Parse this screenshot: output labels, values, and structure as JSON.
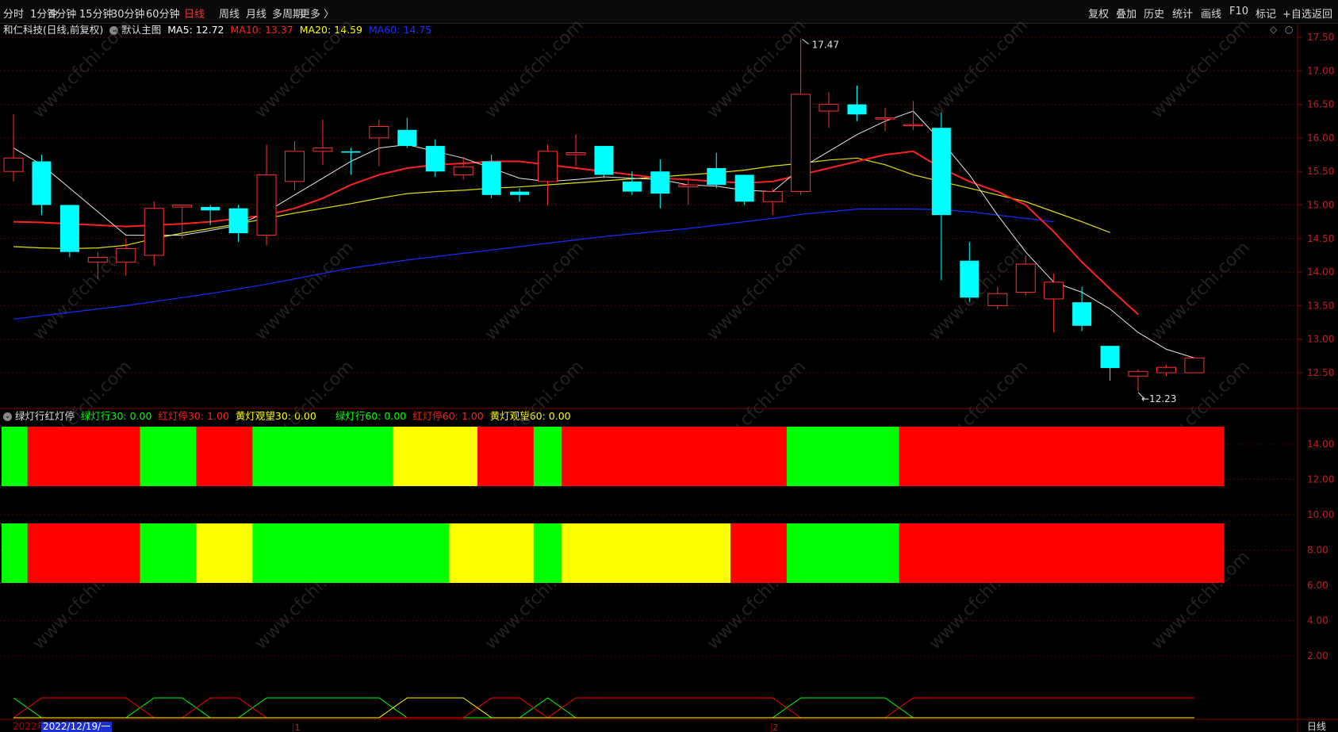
{
  "toolbar": {
    "left_items": [
      "分时",
      "1分钟",
      "5分钟",
      "15分钟",
      "30分钟",
      "60分钟",
      "日线",
      "周线",
      "月线",
      "多周期",
      "更多 〉"
    ],
    "active": "日线",
    "right_items": [
      "复权",
      "叠加",
      "历史",
      "统计",
      "画线",
      "F10",
      "标记",
      "+自选",
      "返回"
    ]
  },
  "main_legend": {
    "title": "和仁科技(日线,前复权)",
    "template": "默认主图",
    "ma": [
      {
        "label": "MA5: 12.72",
        "color": "#ffffff"
      },
      {
        "label": "MA10: 13.37",
        "color": "#ff2020"
      },
      {
        "label": "MA20: 14.59",
        "color": "#ffff00"
      },
      {
        "label": "MA60: 14.75",
        "color": "#2030ff"
      }
    ]
  },
  "indicator_legend": {
    "title": "绿灯行红灯停",
    "items": [
      {
        "label": "绿灯行30: 0.00",
        "color": "#00ff00"
      },
      {
        "label": "红灯停30: 1.00",
        "color": "#ff2020"
      },
      {
        "label": "黄灯观望30: 0.00",
        "color": "#ffff00"
      },
      {
        "label": "绿灯行60: 0.00",
        "color": "#00ff00"
      },
      {
        "label": "红灯停60: 1.00",
        "color": "#ff2020"
      },
      {
        "label": "黄灯观望60: 0.00",
        "color": "#ffff00"
      }
    ]
  },
  "price_axis": [
    "17.50",
    "17.00",
    "16.50",
    "16.00",
    "15.50",
    "15.00",
    "14.50",
    "14.00",
    "13.50",
    "13.00",
    "12.50"
  ],
  "indicator_axis": [
    "14.00",
    "12.00",
    "10.00",
    "8.00",
    "6.00",
    "4.00",
    "2.00"
  ],
  "annotations": {
    "high": "17.47",
    "low": "12.23"
  },
  "bottom": {
    "prefix": "2022年",
    "date": "2022/12/19/一",
    "month_marks": [
      "1",
      "2"
    ],
    "period": "日线"
  },
  "watermark": "www.cfchi.com",
  "colors": {
    "up": "#ff3030",
    "down": "#00ffff",
    "green": "#00ff00",
    "red": "#ff0000",
    "yellow": "#ffff00",
    "grid": "#5a0000"
  },
  "chart_data": {
    "type": "candlestick",
    "candles": [
      {
        "o": 15.5,
        "c": 15.7,
        "h": 16.35,
        "l": 15.35
      },
      {
        "o": 15.65,
        "c": 15.0,
        "h": 15.75,
        "l": 14.85
      },
      {
        "o": 15.0,
        "c": 14.3,
        "h": 15.0,
        "l": 14.22
      },
      {
        "o": 14.15,
        "c": 14.22,
        "h": 14.3,
        "l": 13.9
      },
      {
        "o": 14.15,
        "c": 14.35,
        "h": 14.5,
        "l": 13.95
      },
      {
        "o": 14.25,
        "c": 14.95,
        "h": 15.05,
        "l": 14.1
      },
      {
        "o": 14.97,
        "c": 15.0,
        "h": 15.0,
        "l": 14.5
      },
      {
        "o": 14.97,
        "c": 14.92,
        "h": 15.0,
        "l": 14.7
      },
      {
        "o": 14.95,
        "c": 14.58,
        "h": 15.0,
        "l": 14.45
      },
      {
        "o": 14.55,
        "c": 15.45,
        "h": 15.9,
        "l": 14.4
      },
      {
        "o": 15.35,
        "c": 15.8,
        "h": 15.95,
        "l": 15.22
      },
      {
        "o": 15.8,
        "c": 15.85,
        "h": 16.27,
        "l": 15.6
      },
      {
        "o": 15.8,
        "c": 15.78,
        "h": 15.85,
        "l": 15.45
      },
      {
        "o": 16.0,
        "c": 16.17,
        "h": 16.27,
        "l": 15.58
      },
      {
        "o": 16.12,
        "c": 15.88,
        "h": 16.3,
        "l": 15.85
      },
      {
        "o": 15.88,
        "c": 15.5,
        "h": 15.98,
        "l": 15.42
      },
      {
        "o": 15.45,
        "c": 15.57,
        "h": 15.72,
        "l": 15.38
      },
      {
        "o": 15.65,
        "c": 15.15,
        "h": 15.75,
        "l": 15.1
      },
      {
        "o": 15.2,
        "c": 15.15,
        "h": 15.25,
        "l": 15.05
      },
      {
        "o": 15.35,
        "c": 15.8,
        "h": 15.9,
        "l": 15.0
      },
      {
        "o": 15.75,
        "c": 15.78,
        "h": 16.05,
        "l": 15.58
      },
      {
        "o": 15.88,
        "c": 15.45,
        "h": 15.88,
        "l": 15.4
      },
      {
        "o": 15.35,
        "c": 15.2,
        "h": 15.5,
        "l": 15.15
      },
      {
        "o": 15.5,
        "c": 15.17,
        "h": 15.68,
        "l": 14.95
      },
      {
        "o": 15.27,
        "c": 15.3,
        "h": 15.4,
        "l": 15.0
      },
      {
        "o": 15.55,
        "c": 15.3,
        "h": 15.78,
        "l": 15.25
      },
      {
        "o": 15.45,
        "c": 15.05,
        "h": 15.45,
        "l": 15.0
      },
      {
        "o": 15.05,
        "c": 15.2,
        "h": 15.25,
        "l": 14.85
      },
      {
        "o": 15.2,
        "c": 16.65,
        "h": 17.47,
        "l": 15.15
      },
      {
        "o": 16.4,
        "c": 16.5,
        "h": 16.68,
        "l": 16.15
      },
      {
        "o": 16.5,
        "c": 16.35,
        "h": 16.78,
        "l": 16.25
      },
      {
        "o": 16.28,
        "c": 16.3,
        "h": 16.45,
        "l": 16.1
      },
      {
        "o": 16.2,
        "c": 16.2,
        "h": 16.55,
        "l": 16.12
      },
      {
        "o": 16.15,
        "c": 14.85,
        "h": 16.38,
        "l": 13.88
      },
      {
        "o": 14.17,
        "c": 13.62,
        "h": 14.45,
        "l": 13.55
      },
      {
        "o": 13.5,
        "c": 13.68,
        "h": 13.78,
        "l": 13.45
      },
      {
        "o": 13.7,
        "c": 14.12,
        "h": 14.25,
        "l": 13.65
      },
      {
        "o": 13.6,
        "c": 13.85,
        "h": 13.98,
        "l": 13.1
      },
      {
        "o": 13.55,
        "c": 13.2,
        "h": 13.78,
        "l": 13.12
      },
      {
        "o": 12.9,
        "c": 12.57,
        "h": 12.9,
        "l": 12.38
      },
      {
        "o": 12.45,
        "c": 12.52,
        "h": 12.55,
        "l": 12.23
      },
      {
        "o": 12.5,
        "c": 12.58,
        "h": 12.62,
        "l": 12.45
      },
      {
        "o": 12.5,
        "c": 12.72,
        "h": 12.72,
        "l": 12.5
      }
    ],
    "ma5": [
      15.85,
      15.6,
      15.25,
      14.9,
      14.55,
      14.55,
      14.55,
      14.62,
      14.7,
      14.9,
      15.15,
      15.4,
      15.65,
      15.85,
      15.9,
      15.8,
      15.7,
      15.55,
      15.4,
      15.35,
      15.38,
      15.42,
      15.4,
      15.38,
      15.3,
      15.28,
      15.22,
      15.2,
      15.55,
      15.8,
      16.05,
      16.25,
      16.4,
      15.95,
      15.45,
      14.85,
      14.3,
      13.85,
      13.7,
      13.45,
      13.1,
      12.85,
      12.72
    ],
    "ma10": [
      14.75,
      14.74,
      14.72,
      14.7,
      14.68,
      14.7,
      14.72,
      14.75,
      14.8,
      14.85,
      14.95,
      15.1,
      15.3,
      15.45,
      15.55,
      15.6,
      15.62,
      15.65,
      15.65,
      15.6,
      15.55,
      15.5,
      15.45,
      15.4,
      15.38,
      15.35,
      15.33,
      15.35,
      15.45,
      15.55,
      15.65,
      15.75,
      15.8,
      15.55,
      15.35,
      15.2,
      15.0,
      14.6,
      14.15,
      13.75,
      13.37
    ],
    "ma10_start": 0,
    "ma20": [
      14.38,
      14.36,
      14.35,
      14.36,
      14.4,
      14.5,
      14.58,
      14.65,
      14.72,
      14.8,
      14.88,
      14.95,
      15.02,
      15.1,
      15.17,
      15.2,
      15.22,
      15.25,
      15.27,
      15.3,
      15.33,
      15.36,
      15.39,
      15.42,
      15.45,
      15.48,
      15.52,
      15.58,
      15.62,
      15.67,
      15.7,
      15.6,
      15.45,
      15.35,
      15.25,
      15.15,
      15.05,
      14.9,
      14.75,
      14.59
    ],
    "ma60": [
      13.3,
      13.35,
      13.4,
      13.45,
      13.5,
      13.56,
      13.62,
      13.68,
      13.75,
      13.82,
      13.9,
      13.98,
      14.06,
      14.12,
      14.18,
      14.23,
      14.28,
      14.33,
      14.38,
      14.43,
      14.48,
      14.53,
      14.57,
      14.61,
      14.65,
      14.7,
      14.75,
      14.8,
      14.86,
      14.9,
      14.94,
      14.94,
      14.94,
      14.93,
      14.9,
      14.85,
      14.8,
      14.75
    ],
    "ind30": [
      "g",
      "r",
      "r",
      "r",
      "r",
      "g",
      "g",
      "r",
      "r",
      "g",
      "g",
      "g",
      "g",
      "g",
      "y",
      "y",
      "y",
      "r",
      "r",
      "g",
      "r",
      "r",
      "r",
      "r",
      "r",
      "r",
      "r",
      "r",
      "g",
      "g",
      "g",
      "g",
      "r",
      "r",
      "r",
      "r",
      "r",
      "r",
      "r",
      "r",
      "r",
      "r",
      "r"
    ],
    "ind60": [
      "g",
      "r",
      "r",
      "r",
      "r",
      "g",
      "g",
      "y",
      "y",
      "g",
      "g",
      "g",
      "g",
      "g",
      "g",
      "g",
      "y",
      "y",
      "y",
      "g",
      "y",
      "y",
      "y",
      "y",
      "y",
      "y",
      "r",
      "r",
      "g",
      "g",
      "g",
      "g",
      "r",
      "r",
      "r",
      "r",
      "r",
      "r",
      "r",
      "r",
      "r",
      "r",
      "r"
    ]
  }
}
